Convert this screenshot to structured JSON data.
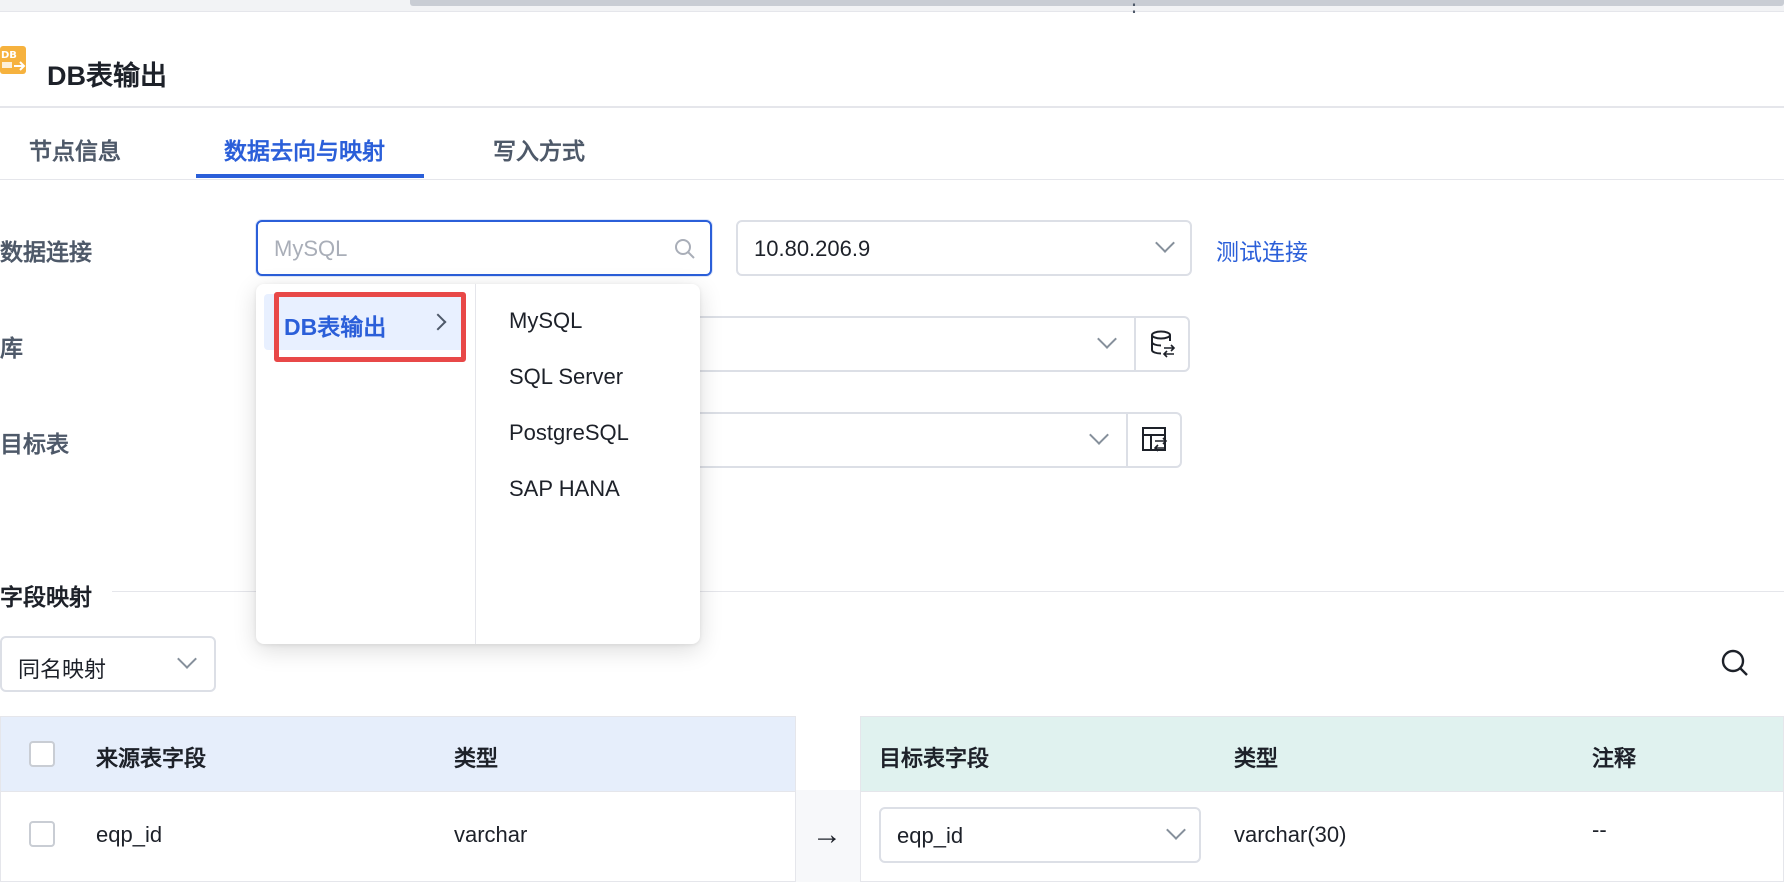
{
  "window": {
    "title": "DB表输出"
  },
  "tabs": [
    {
      "label": "节点信息",
      "active": false
    },
    {
      "label": "数据去向与映射",
      "active": true
    },
    {
      "label": "写入方式",
      "active": false
    }
  ],
  "form": {
    "connection_label": "数据连接",
    "connection_type_placeholder": "MySQL",
    "connection_host": "10.80.206.9",
    "test_connection_link": "测试连接",
    "database_label": "库",
    "target_table_label": "目标表"
  },
  "dropdown": {
    "category": "DB表输出",
    "options": [
      "MySQL",
      "SQL Server",
      "PostgreSQL",
      "SAP HANA"
    ]
  },
  "field_mapping": {
    "section_title": "字段映射",
    "mapping_mode": "同名映射",
    "source_table": {
      "headers": [
        "来源表字段",
        "类型"
      ],
      "rows": [
        {
          "field": "eqp_id",
          "type": "varchar"
        }
      ]
    },
    "target_table": {
      "headers": [
        "目标表字段",
        "类型",
        "注释"
      ],
      "rows": [
        {
          "field": "eqp_id",
          "type": "varchar(30)",
          "comment": "--"
        }
      ]
    },
    "arrow": "→"
  },
  "colors": {
    "accent": "#2b5fd9",
    "highlight": "#e84848",
    "source_header_bg": "#e6eefb",
    "target_header_bg": "#e0f2ef"
  }
}
